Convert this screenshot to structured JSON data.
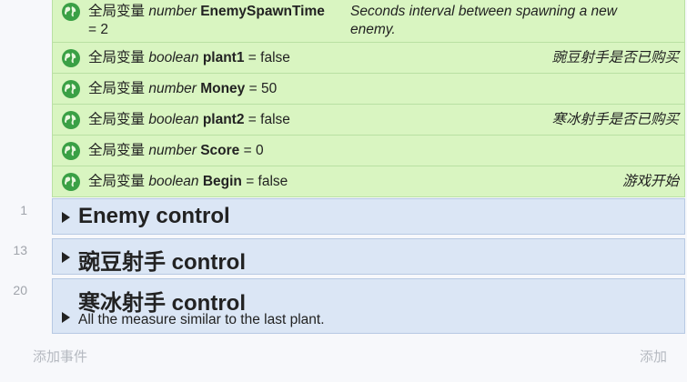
{
  "globals": [
    {
      "prefix": "全局变量",
      "type": "number",
      "name": "EnemySpawnTime",
      "assign": "= 2",
      "comment": "Seconds interval between spawning a new enemy."
    },
    {
      "prefix": "全局变量",
      "type": "boolean",
      "name": "plant1",
      "assign": "= false",
      "comment": "豌豆射手是否已购买"
    },
    {
      "prefix": "全局变量",
      "type": "number",
      "name": "Money",
      "assign": "= 50",
      "comment": ""
    },
    {
      "prefix": "全局变量",
      "type": "boolean",
      "name": "plant2",
      "assign": "= false",
      "comment": "寒冰射手是否已购买"
    },
    {
      "prefix": "全局变量",
      "type": "number",
      "name": "Score",
      "assign": "= 0",
      "comment": ""
    },
    {
      "prefix": "全局变量",
      "type": "boolean",
      "name": "Begin",
      "assign": "= false",
      "comment": "游戏开始"
    }
  ],
  "groups": [
    {
      "line": "1",
      "title": "Enemy control",
      "description": ""
    },
    {
      "line": "13",
      "title": "豌豆射手 control",
      "description": ""
    },
    {
      "line": "20",
      "title": "寒冰射手 control",
      "description": "All the measure similar to the last plant."
    }
  ],
  "footer": {
    "add_event": "添加事件",
    "add": "添加"
  },
  "colors": {
    "variable_bg": "#d9f5c1",
    "group_bg": "#dbe6f5",
    "globe": "#3aa045"
  }
}
